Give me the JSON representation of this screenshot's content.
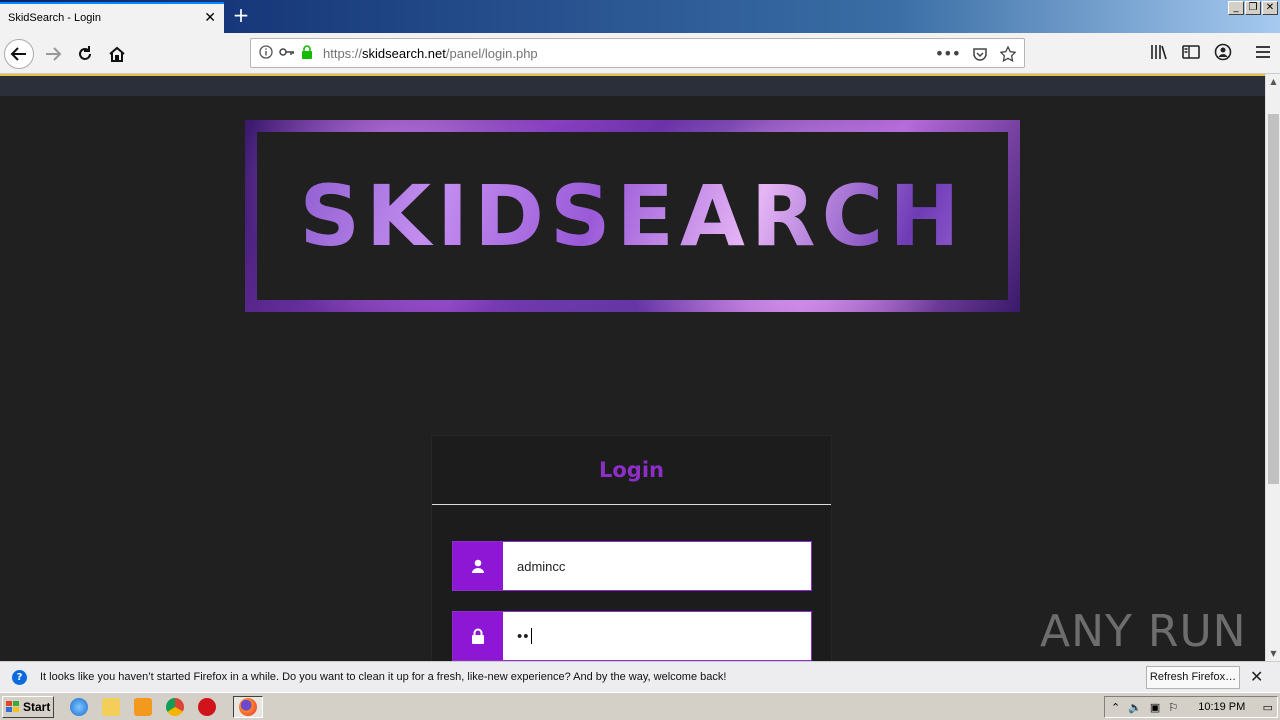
{
  "browser": {
    "tab_title": "SkidSearch - Login",
    "url_scheme": "https://",
    "url_host": "skidsearch.net",
    "url_path": "/panel/login.php"
  },
  "page": {
    "logo_text": "SKIDSEARCH",
    "login_title": "Login",
    "username_value": "admincc",
    "password_value": "••"
  },
  "watermark": {
    "text": "ANY RUN"
  },
  "notification": {
    "text": "It looks like you haven’t started Firefox in a while. Do you want to clean it up for a fresh, like-new experience? And by the way, welcome back!",
    "button_label": "Refresh Firefox…"
  },
  "taskbar": {
    "start_label": "Start",
    "clock": "10:19 PM"
  },
  "colors": {
    "accent_purple": "#8e17d6",
    "page_bg": "#202021"
  }
}
